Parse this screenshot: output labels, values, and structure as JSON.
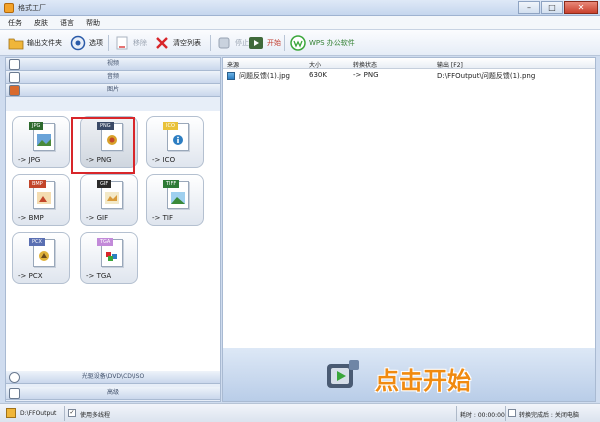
{
  "window": {
    "title": "格式工厂"
  },
  "menu": [
    "任务",
    "皮肤",
    "语言",
    "帮助"
  ],
  "toolbar": {
    "output_folder": "输出文件夹",
    "options": "选项",
    "remove": "移除",
    "clear_list": "清空列表",
    "stop": "停止",
    "start": "开始",
    "wps": "WPS 办公软件"
  },
  "categories": {
    "video": "视频",
    "audio": "音频",
    "image": "图片",
    "rom": "光驱设备\\DVD\\CD\\ISO",
    "advanced": "高级"
  },
  "formats": [
    {
      "badge": "JPG",
      "label": "-> JPG",
      "color": "#2e6a2e"
    },
    {
      "badge": "PNG",
      "label": "-> PNG",
      "color": "#3b4a66"
    },
    {
      "badge": "ICO",
      "label": "-> ICO",
      "color": "#e9c23a"
    },
    {
      "badge": "BMP",
      "label": "-> BMP",
      "color": "#c2452a"
    },
    {
      "badge": "GIF",
      "label": "-> GIF",
      "color": "#2a2a2a"
    },
    {
      "badge": "TIFF",
      "label": "-> TIF",
      "color": "#2e7a36"
    },
    {
      "badge": "PCX",
      "label": "-> PCX",
      "color": "#5a6fb2"
    },
    {
      "badge": "TGA",
      "label": "-> TGA",
      "color": "#c28ad9"
    }
  ],
  "table": {
    "headers": [
      "来源",
      "大小",
      "转换状态",
      "输出 [F2]"
    ],
    "rows": [
      {
        "source": "问题反馈(1).jpg",
        "size": "630K",
        "status": "-> PNG",
        "output": "D:\\FFOutput\\问题反馈(1).png"
      }
    ]
  },
  "start_area": {
    "label": "点击开始"
  },
  "status": {
    "output_path": "D:\\FFOutput",
    "multithread": "使用多线程",
    "elapsed": "耗时 : 00:00:00",
    "after_done": "转换完成后 : 关闭电脑"
  },
  "colors": {
    "accent": "#f08a10",
    "selection": "#d8262a"
  }
}
